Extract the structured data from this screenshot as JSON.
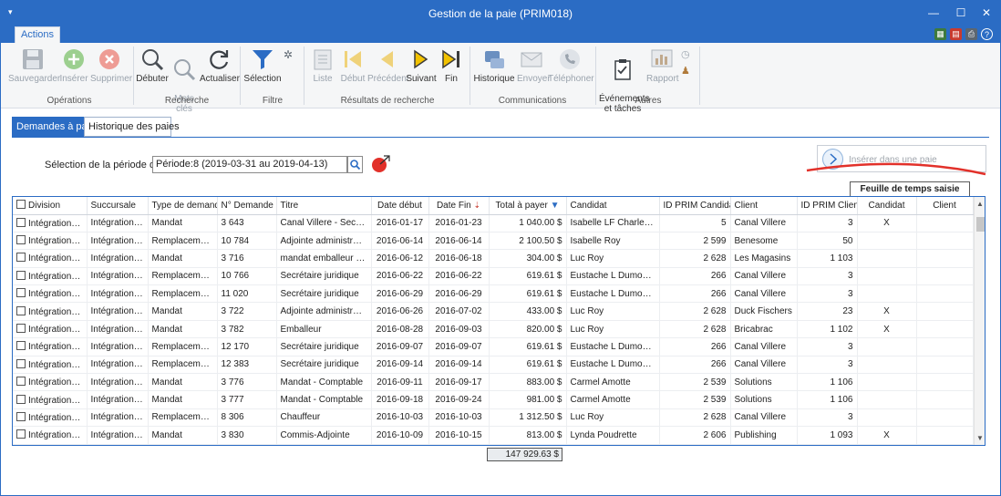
{
  "window": {
    "title": "Gestion de la paie (PRIM018)",
    "minimize": "—",
    "maximize": "☐",
    "close": "✕"
  },
  "ribbon_tab": "Actions",
  "ribbon": {
    "groups": [
      {
        "label": "Opérations"
      },
      {
        "label": "Recherche"
      },
      {
        "label": "Filtre"
      },
      {
        "label": "Résultats de recherche"
      },
      {
        "label": "Communications"
      },
      {
        "label": "Autres"
      }
    ],
    "buttons": {
      "sauvegarder": "Sauvegarder",
      "inserer": "Insérer",
      "supprimer": "Supprimer",
      "debuter": "Débuter",
      "mots_cles": "Mots\nclés",
      "actualiser": "Actualiser",
      "selection": "Sélection",
      "liste": "Liste",
      "debut": "Début",
      "precedent": "Précédent",
      "suivant": "Suivant",
      "fin": "Fin",
      "historique": "Historique",
      "envoyer": "Envoyer",
      "telephoner": "Téléphoner",
      "evenements": "Événements\net tâches",
      "rapport": "Rapport"
    }
  },
  "subtabs": {
    "demandes": "Demandes à payer",
    "historique": "Historique des paies"
  },
  "period": {
    "label": "Sélection de la période de paie",
    "value": "Période:8 (2019-03-31 au 2019-04-13)"
  },
  "insert_button": "Insérer dans une paie",
  "feuille_header": "Feuille de temps saisie",
  "columns": [
    "Division",
    "Succursale",
    "Type de demande",
    "N° Demande",
    "Titre",
    "Date début",
    "Date Fin",
    "Total à payer",
    "Candidat",
    "ID PRIM Candidat",
    "Client",
    "ID PRIM Client",
    "Candidat",
    "Client"
  ],
  "rows": [
    [
      "Intégration Inc.",
      "Intégration Inc.",
      "Mandat",
      "3 643",
      "Canal Villere - Sec. Juri...",
      "2016-01-17",
      "2016-01-23",
      "1 040.00 $",
      "Isabelle LF Charlebois",
      "5",
      "Canal Villere",
      "3",
      "X",
      ""
    ],
    [
      "Intégration Inc.",
      "Intégration Inc.",
      "Remplacement",
      "10 784",
      "Adjointe administrative",
      "2016-06-14",
      "2016-06-14",
      "2 100.50 $",
      "Isabelle Roy",
      "2 599",
      "Benesome",
      "50",
      "",
      ""
    ],
    [
      "Intégration Inc.",
      "Intégration Inc.",
      "Mandat",
      "3 716",
      "mandat emballeur mag",
      "2016-06-12",
      "2016-06-18",
      "304.00 $",
      "Luc Roy",
      "2 628",
      "Les Magasins",
      "1 103",
      "",
      ""
    ],
    [
      "Intégration Inc.",
      "Intégration Inc.",
      "Remplacement",
      "10 766",
      "Secrétaire juridique",
      "2016-06-22",
      "2016-06-22",
      "619.61 $",
      "Eustache L Dumoulin",
      "266",
      "Canal Villere",
      "3",
      "",
      ""
    ],
    [
      "Intégration Inc.",
      "Intégration Inc.",
      "Remplacement",
      "11 020",
      "Secrétaire juridique",
      "2016-06-29",
      "2016-06-29",
      "619.61 $",
      "Eustache L Dumoulin",
      "266",
      "Canal Villere",
      "3",
      "",
      ""
    ],
    [
      "Intégration Inc.",
      "Intégration Inc.",
      "Mandat",
      "3 722",
      "Adjointe administrati...",
      "2016-06-26",
      "2016-07-02",
      "433.00 $",
      "Luc Roy",
      "2 628",
      "Duck Fischers",
      "23",
      "X",
      ""
    ],
    [
      "Intégration Inc.",
      "Intégration Inc.",
      "Mandat",
      "3 782",
      "Emballeur",
      "2016-08-28",
      "2016-09-03",
      "820.00 $",
      "Luc Roy",
      "2 628",
      "Bricabrac",
      "1 102",
      "X",
      ""
    ],
    [
      "Intégration Inc.",
      "Intégration Inc.",
      "Remplacement",
      "12 170",
      "Secrétaire juridique",
      "2016-09-07",
      "2016-09-07",
      "619.61 $",
      "Eustache L Dumoulin",
      "266",
      "Canal Villere",
      "3",
      "",
      ""
    ],
    [
      "Intégration Inc.",
      "Intégration Inc.",
      "Remplacement",
      "12 383",
      "Secrétaire juridique",
      "2016-09-14",
      "2016-09-14",
      "619.61 $",
      "Eustache L Dumoulin",
      "266",
      "Canal Villere",
      "3",
      "",
      ""
    ],
    [
      "Intégration Inc.",
      "Intégration Inc.",
      "Mandat",
      "3 776",
      "Mandat - Comptable",
      "2016-09-11",
      "2016-09-17",
      "883.00 $",
      "Carmel Amotte",
      "2 539",
      "Solutions",
      "1 106",
      "",
      ""
    ],
    [
      "Intégration Inc.",
      "Intégration Inc.",
      "Mandat",
      "3 777",
      "Mandat - Comptable",
      "2016-09-18",
      "2016-09-24",
      "981.00 $",
      "Carmel Amotte",
      "2 539",
      "Solutions",
      "1 106",
      "",
      ""
    ],
    [
      "Intégration Inc.",
      "Intégration Inc.",
      "Remplacement",
      "8 306",
      "Chauffeur",
      "2016-10-03",
      "2016-10-03",
      "1 312.50 $",
      "Luc Roy",
      "2 628",
      "Canal Villere",
      "3",
      "",
      ""
    ],
    [
      "Intégration Inc.",
      "Intégration Inc.",
      "Mandat",
      "3 830",
      "Commis-Adjointe",
      "2016-10-09",
      "2016-10-15",
      "813.00 $",
      "Lynda Poudrette",
      "2 606",
      "Publishing",
      "1 093",
      "X",
      ""
    ]
  ],
  "total": "147 929.63 $",
  "colors": {
    "accent": "#2b6cc4",
    "annotation": "#e2312a"
  }
}
